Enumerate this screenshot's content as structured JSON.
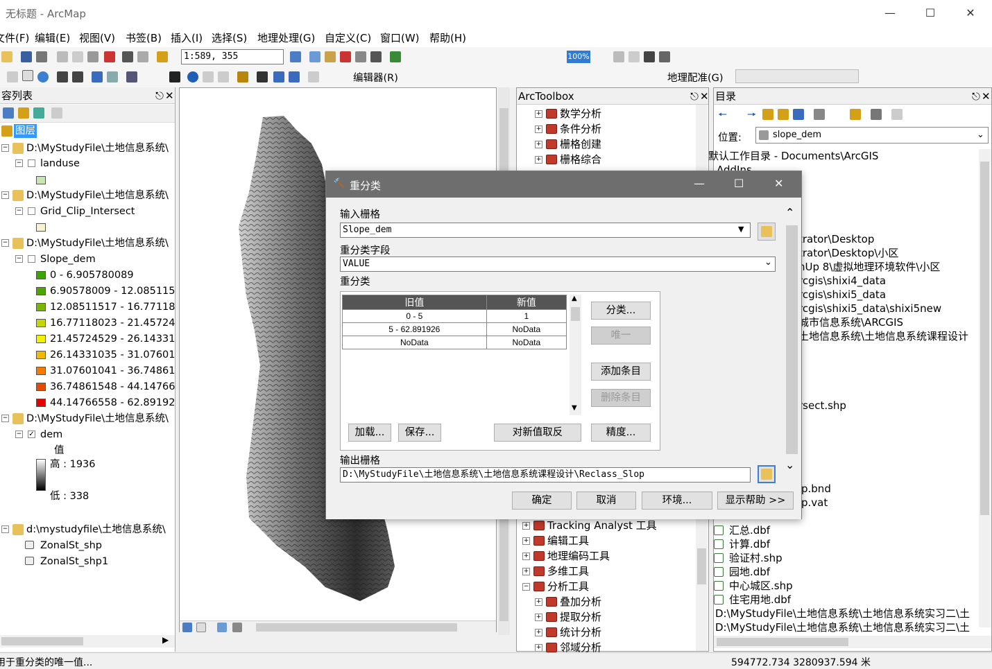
{
  "app": {
    "title": "无标题 - ArcMap"
  },
  "menu": [
    "文件(F)",
    "编辑(E)",
    "视图(V)",
    "书签(B)",
    "插入(I)",
    "选择(S)",
    "地理处理(G)",
    "自定义(C)",
    "窗口(W)",
    "帮助(H)"
  ],
  "toolbar": {
    "scale": "1:589, 355",
    "zoom": "100%",
    "editor": "编辑器(R)",
    "georef": "地理配准(G)"
  },
  "toc": {
    "title": "容列表",
    "layers_label": "图层",
    "groups": [
      {
        "path": "D:\\MyStudyFile\\土地信息系统\\",
        "layer": "landuse",
        "checked": false
      },
      {
        "path": "D:\\MyStudyFile\\土地信息系统\\",
        "layer": "Grid_Clip_Intersect",
        "checked": false
      },
      {
        "path": "D:\\MyStudyFile\\土地信息系统\\",
        "layer": "Slope_dem",
        "checked": false
      },
      {
        "path": "D:\\MyStudyFile\\土地信息系统\\",
        "layer": "dem",
        "checked": true
      }
    ],
    "slope_classes": [
      {
        "label": "0 - 6.905780089",
        "color": "#38a800"
      },
      {
        "label": "6.90578009 - 12.085115",
        "color": "#4ca600"
      },
      {
        "label": "12.08511517 - 16.77118",
        "color": "#7ab800"
      },
      {
        "label": "16.77118023 - 21.45724",
        "color": "#c6d600"
      },
      {
        "label": "21.45724529 - 26.14331",
        "color": "#f2f200"
      },
      {
        "label": "26.14331035 - 31.07601",
        "color": "#f5b800"
      },
      {
        "label": "31.07601041 - 36.74861",
        "color": "#f57a00"
      },
      {
        "label": "36.74861548 - 44.14766",
        "color": "#e84a00"
      },
      {
        "label": "44.14766558 - 62.89192",
        "color": "#e60000"
      }
    ],
    "dem_value_label": "值",
    "dem_high": "高 : 1936",
    "dem_low": "低 : 338",
    "zonal_group": "d:\\mystudyfile\\土地信息系统\\",
    "zonal_items": [
      "ZonalSt_shp",
      "ZonalSt_shp1"
    ]
  },
  "toolbox": {
    "title": "ArcToolbox",
    "top_items": [
      "数学分析",
      "条件分析",
      "栅格创建",
      "栅格综合"
    ],
    "bottom_items": [
      "Tracking Analyst 工具",
      "编辑工具",
      "地理编码工具",
      "多维工具",
      "分析工具"
    ],
    "sub_items": [
      "叠加分析",
      "提取分析",
      "统计分析",
      "邻域分析"
    ]
  },
  "catalog": {
    "title": "目录",
    "location_label": "位置:",
    "location_value": "slope_dem",
    "rows_top": [
      "默认工作目录 - Documents\\ArcGIS",
      "AddIns"
    ],
    "rows_partial": [
      "trator\\Desktop",
      "trator\\Desktop\\小区",
      "nUp 8\\虚拟地理环境软件\\小区",
      "rcgis\\shixi4_data",
      "rcgis\\shixi5_data",
      "rcgis\\shixi5_data\\shixi5new",
      "城市信息系统\\ARCGIS",
      "土地信息系统\\土地信息系统课程设计"
    ],
    "rows_partial2": [
      "rsect.shp",
      "p.bnd",
      "p.vat"
    ],
    "rows_bottom": [
      "汇总.dbf",
      "计算.dbf",
      "验证村.shp",
      "园地.dbf",
      "中心城区.shp",
      "住宅用地.dbf"
    ],
    "rows_paths": [
      "D:\\MyStudyFile\\土地信息系统\\土地信息系统实习二\\土",
      "D:\\MyStudyFile\\土地信息系统\\土地信息系统实习二\\土"
    ]
  },
  "dialog": {
    "title": "重分类",
    "input_label": "输入栅格",
    "input_value": "Slope_dem",
    "field_label": "重分类字段",
    "field_value": "VALUE",
    "reclass_label": "重分类",
    "col_old": "旧值",
    "col_new": "新值",
    "rows": [
      {
        "old": "0 - 5",
        "new": "1"
      },
      {
        "old": "5 - 62.891926",
        "new": "NoData"
      },
      {
        "old": "NoData",
        "new": "NoData"
      }
    ],
    "btn_classify": "分类...",
    "btn_unique": "唯一",
    "btn_add": "添加条目",
    "btn_delete": "删除条目",
    "btn_load": "加载...",
    "btn_save": "保存...",
    "btn_reverse": "对新值取反",
    "btn_precision": "精度...",
    "output_label": "输出栅格",
    "output_value": "D:\\MyStudyFile\\土地信息系统\\土地信息系统课程设计\\Reclass_Slop",
    "btn_ok": "确定",
    "btn_cancel": "取消",
    "btn_env": "环境...",
    "btn_help": "显示帮助 >>"
  },
  "status": {
    "message": "用于重分类的唯一值...",
    "coords": "594772.734  3280937.594 米"
  }
}
